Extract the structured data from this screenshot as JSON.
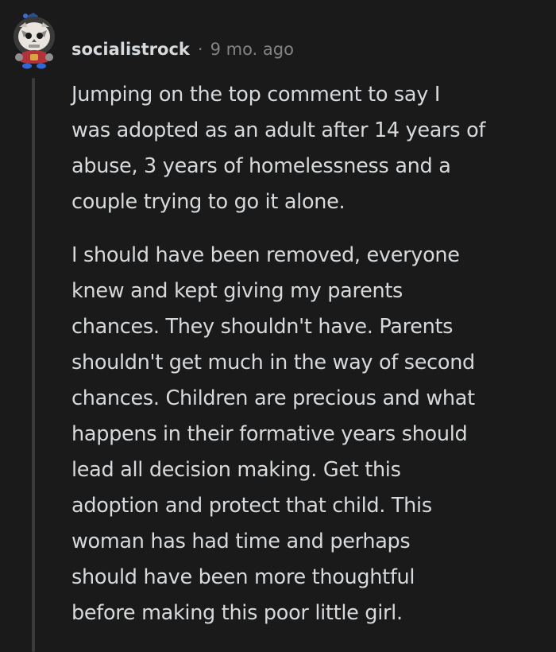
{
  "comment": {
    "username": "socialistrock",
    "separator": "·",
    "timestamp": "9 mo. ago",
    "paragraphs": [
      [
        "Jumping on the top comment to say I",
        "was adopted as an adult after 14 years of",
        "abuse, 3 years of homelessness and a",
        "couple trying to go it alone."
      ],
      [
        "I should have been removed, everyone",
        "knew and kept giving my parents",
        "chances. They shouldn't have. Parents",
        "shouldn't get much in the way of second",
        "chances. Children are precious and what",
        "happens in their formative years should",
        "lead all decision making. Get this",
        "adoption and protect that child. This",
        "woman has had time and perhaps",
        "should have been more thoughtful",
        "before making this poor little girl."
      ]
    ]
  },
  "colors": {
    "background": "#1a1a1b",
    "text": "#d7dadc",
    "meta": "#818384",
    "thread_line": "#3a3b3c"
  },
  "icons": {
    "avatar": "snoo-avatar-icon"
  }
}
